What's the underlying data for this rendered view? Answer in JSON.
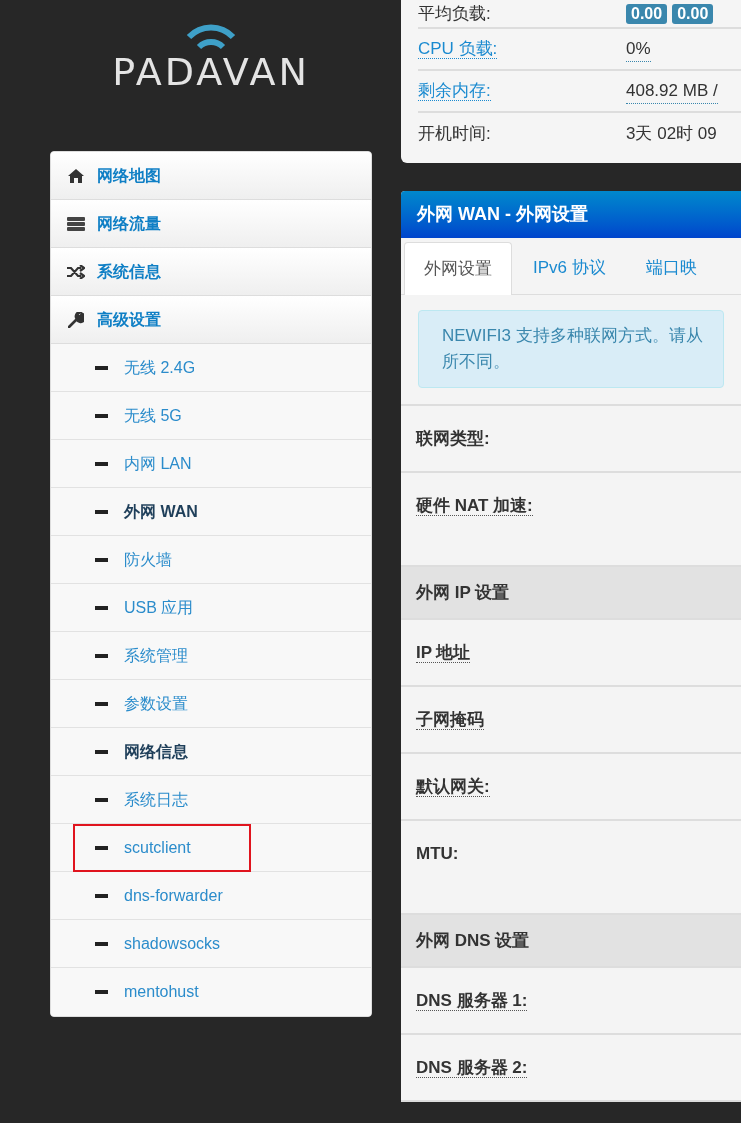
{
  "logo": {
    "text": "PADAVAN"
  },
  "status": {
    "rows": [
      {
        "label": "平均负载:",
        "link": false,
        "badges": [
          "0.00",
          "0.00"
        ]
      },
      {
        "label": "CPU 负载:",
        "link": true,
        "value": "0%"
      },
      {
        "label": "剩余内存:",
        "link": true,
        "value": "408.92 MB /"
      },
      {
        "label": "开机时间:",
        "link": false,
        "value": "3天 02时 09"
      }
    ]
  },
  "sidebar": {
    "items": [
      {
        "label": "网络地图"
      },
      {
        "label": "网络流量"
      },
      {
        "label": "系统信息"
      },
      {
        "label": "高级设置",
        "children": [
          {
            "label": "无线 2.4G",
            "selected": false,
            "highlighted": false
          },
          {
            "label": "无线 5G",
            "selected": false,
            "highlighted": false
          },
          {
            "label": "内网 LAN",
            "selected": false,
            "highlighted": false
          },
          {
            "label": "外网 WAN",
            "selected": true,
            "highlighted": false
          },
          {
            "label": "防火墙",
            "selected": false,
            "highlighted": false
          },
          {
            "label": "USB 应用",
            "selected": false,
            "highlighted": false
          },
          {
            "label": "系统管理",
            "selected": false,
            "highlighted": false
          },
          {
            "label": "参数设置",
            "selected": false,
            "highlighted": false
          },
          {
            "label": "网络信息",
            "selected": true,
            "highlighted": false
          },
          {
            "label": "系统日志",
            "selected": false,
            "highlighted": false
          },
          {
            "label": "scutclient",
            "selected": false,
            "highlighted": true
          },
          {
            "label": "dns-forwarder",
            "selected": false,
            "highlighted": false
          },
          {
            "label": "shadowsocks",
            "selected": false,
            "highlighted": false
          },
          {
            "label": "mentohust",
            "selected": false,
            "highlighted": false
          }
        ]
      }
    ]
  },
  "panel": {
    "title": "外网 WAN - 外网设置",
    "tabs": [
      {
        "label": "外网设置",
        "selected": true
      },
      {
        "label": "IPv6 协议",
        "selected": false
      },
      {
        "label": "端口映",
        "selected": false
      }
    ],
    "alert": [
      "NEWIFI3 支持多种联网方式。请从",
      "所不同。"
    ],
    "rows": [
      {
        "kind": "field",
        "label": "联网类型:",
        "tooltip": false,
        "tall": false
      },
      {
        "kind": "field",
        "label": "硬件 NAT 加速:",
        "tooltip": true,
        "tall": true
      },
      {
        "kind": "section",
        "label": "外网 IP 设置"
      },
      {
        "kind": "field",
        "label": "IP 地址",
        "tooltip": true,
        "tall": false
      },
      {
        "kind": "field",
        "label": "子网掩码",
        "tooltip": true,
        "tall": false
      },
      {
        "kind": "field",
        "label": "默认网关:",
        "tooltip": true,
        "tall": false
      },
      {
        "kind": "field",
        "label": "MTU:",
        "tooltip": false,
        "tall": true
      },
      {
        "kind": "section",
        "label": "外网 DNS 设置"
      },
      {
        "kind": "field",
        "label": "DNS 服务器 1:",
        "tooltip": true,
        "tall": false
      },
      {
        "kind": "field",
        "label": "DNS 服务器 2:",
        "tooltip": true,
        "tall": false
      }
    ]
  }
}
